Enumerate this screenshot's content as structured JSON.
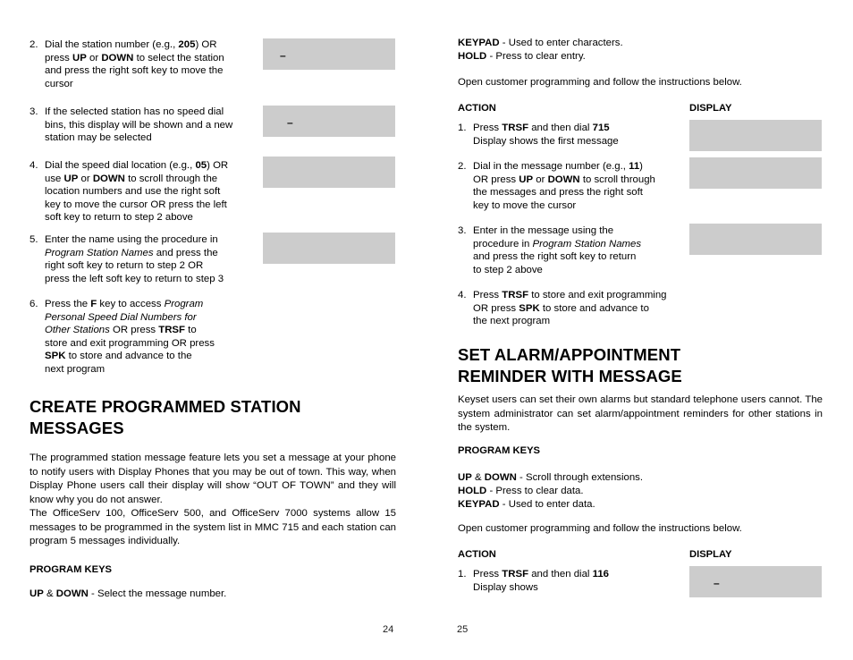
{
  "document": {
    "page_numbers": {
      "left": "24",
      "right": "25"
    },
    "display_box_marker": "–"
  },
  "left_column": {
    "steps": [
      {
        "num": "2.",
        "lines": [
          [
            {
              "t": "Dial the station number (e.g., ",
              "s": "n"
            },
            {
              "t": "205",
              "s": "b"
            },
            {
              "t": ") OR",
              "s": "n"
            }
          ],
          [
            {
              "t": "press ",
              "s": "n"
            },
            {
              "t": "UP",
              "s": "b"
            },
            {
              "t": " or ",
              "s": "n"
            },
            {
              "t": "DOWN",
              "s": "b"
            },
            {
              "t": " to select the station",
              "s": "n"
            }
          ],
          [
            {
              "t": "and press the right soft key to move the",
              "s": "n"
            }
          ],
          [
            {
              "t": "cursor",
              "s": "n"
            }
          ]
        ]
      },
      {
        "num": "3.",
        "lines": [
          [
            {
              "t": "If the selected station has no speed dial",
              "s": "n"
            }
          ],
          [
            {
              "t": "bins, this display will be shown and a new",
              "s": "n"
            }
          ],
          [
            {
              "t": "station may be selected",
              "s": "n"
            }
          ]
        ]
      },
      {
        "num": "4.",
        "lines": [
          [
            {
              "t": "Dial the speed dial location (e.g., ",
              "s": "n"
            },
            {
              "t": "05",
              "s": "b"
            },
            {
              "t": ") OR",
              "s": "n"
            }
          ],
          [
            {
              "t": "use ",
              "s": "n"
            },
            {
              "t": "UP",
              "s": "b"
            },
            {
              "t": " or ",
              "s": "n"
            },
            {
              "t": "DOWN",
              "s": "b"
            },
            {
              "t": " to scroll through the",
              "s": "n"
            }
          ],
          [
            {
              "t": "location numbers and use the right soft",
              "s": "n"
            }
          ],
          [
            {
              "t": "key to move the cursor OR press the left",
              "s": "n"
            }
          ],
          [
            {
              "t": "soft key to return to step 2 above",
              "s": "n"
            }
          ]
        ]
      },
      {
        "num": "5.",
        "lines": [
          [
            {
              "t": "Enter the name using the procedure in",
              "s": "n"
            }
          ],
          [
            {
              "t": "Program Station Names",
              "s": "i"
            },
            {
              "t": " and press the",
              "s": "n"
            }
          ],
          [
            {
              "t": "right soft key to return to step 2 OR",
              "s": "n"
            }
          ],
          [
            {
              "t": "press the left soft key to return to step 3",
              "s": "n"
            }
          ]
        ]
      },
      {
        "num": "6.",
        "lines": [
          [
            {
              "t": "Press the ",
              "s": "n"
            },
            {
              "t": "F",
              "s": "b"
            },
            {
              "t": " key to access ",
              "s": "n"
            },
            {
              "t": "Program",
              "s": "i"
            }
          ],
          [
            {
              "t": "Personal Speed Dial Numbers for",
              "s": "i"
            }
          ],
          [
            {
              "t": "Other Stations",
              "s": "i"
            },
            {
              "t": " OR press ",
              "s": "n"
            },
            {
              "t": "TRSF",
              "s": "b"
            },
            {
              "t": " to",
              "s": "n"
            }
          ],
          [
            {
              "t": "store and exit programming OR press",
              "s": "n"
            }
          ],
          [
            {
              "t": "SPK",
              "s": "b"
            },
            {
              "t": " to store and advance to the",
              "s": "n"
            }
          ],
          [
            {
              "t": "next program",
              "s": "n"
            }
          ]
        ]
      }
    ],
    "display_boxes": [
      {
        "marker": "–"
      },
      {
        "marker": "–"
      },
      {
        "marker": ""
      },
      {
        "marker": ""
      }
    ],
    "heading": {
      "line1": "CREATE PROGRAMMED STATION",
      "line2": "MESSAGES"
    },
    "paragraph_1": "The programmed station message feature lets you set a message at your phone to notify users with Display Phones that you may be out of town. This way, when Display Phone users call their display will show “OUT OF TOWN” and they will know why you do not answer.",
    "paragraph_2": "The OfficeServ 100, OfficeServ 500, and OfficeServ 7000 systems allow 15 messages to be programmed in the system list in MMC 715 and each station can program 5 messages individually.",
    "program_keys_heading": "PROGRAM KEYS",
    "program_keys": [
      [
        {
          "t": "UP",
          "s": "b"
        },
        {
          "t": " & ",
          "s": "n"
        },
        {
          "t": "DOWN",
          "s": "b"
        },
        {
          "t": " - Select the message number.",
          "s": "n"
        }
      ]
    ]
  },
  "right_column": {
    "key_defs_top": [
      [
        {
          "t": "KEYPAD",
          "s": "b"
        },
        {
          "t": " - Used to enter characters.",
          "s": "n"
        }
      ],
      [
        {
          "t": "HOLD",
          "s": "b"
        },
        {
          "t": " - Press to clear entry.",
          "s": "n"
        }
      ]
    ],
    "open_programming_1": "Open customer programming and follow the instructions below.",
    "table_head_1": {
      "action": "ACTION",
      "display": "DISPLAY"
    },
    "steps_1": [
      {
        "num": "1.",
        "lines": [
          [
            {
              "t": "Press ",
              "s": "n"
            },
            {
              "t": "TRSF",
              "s": "b"
            },
            {
              "t": " and then dial ",
              "s": "n"
            },
            {
              "t": "715",
              "s": "b"
            }
          ],
          [
            {
              "t": "Display shows the first message",
              "s": "n"
            }
          ]
        ]
      },
      {
        "num": "2.",
        "lines": [
          [
            {
              "t": "Dial in the message number (e.g., ",
              "s": "n"
            },
            {
              "t": "11",
              "s": "b"
            },
            {
              "t": ")",
              "s": "n"
            }
          ],
          [
            {
              "t": "OR press ",
              "s": "n"
            },
            {
              "t": "UP",
              "s": "b"
            },
            {
              "t": " or ",
              "s": "n"
            },
            {
              "t": "DOWN",
              "s": "b"
            },
            {
              "t": " to scroll through",
              "s": "n"
            }
          ],
          [
            {
              "t": "the messages and press the right soft",
              "s": "n"
            }
          ],
          [
            {
              "t": "key to move the cursor",
              "s": "n"
            }
          ]
        ]
      },
      {
        "num": "3.",
        "lines": [
          [
            {
              "t": "Enter in the message using the",
              "s": "n"
            }
          ],
          [
            {
              "t": "procedure in ",
              "s": "n"
            },
            {
              "t": "Program Station Names",
              "s": "i"
            }
          ],
          [
            {
              "t": "and press the right soft key to return",
              "s": "n"
            }
          ],
          [
            {
              "t": "to step 2 above",
              "s": "n"
            }
          ]
        ]
      },
      {
        "num": "4.",
        "lines": [
          [
            {
              "t": "Press ",
              "s": "n"
            },
            {
              "t": "TRSF",
              "s": "b"
            },
            {
              "t": " to store and exit programming",
              "s": "n"
            }
          ],
          [
            {
              "t": "OR press ",
              "s": "n"
            },
            {
              "t": "SPK",
              "s": "b"
            },
            {
              "t": " to store and advance to",
              "s": "n"
            }
          ],
          [
            {
              "t": "the next program",
              "s": "n"
            }
          ]
        ]
      }
    ],
    "display_boxes_1": [
      {
        "marker": ""
      },
      {
        "marker": ""
      },
      {
        "marker": ""
      }
    ],
    "heading": {
      "line1": "SET ALARM/APPOINTMENT",
      "line2": "REMINDER WITH MESSAGE"
    },
    "paragraph": "Keyset users can set their own alarms but standard telephone users cannot. The system administrator can set alarm/appointment reminders for other stations in the system.",
    "program_keys_heading": "PROGRAM KEYS",
    "program_keys": [
      [
        {
          "t": "UP",
          "s": "b"
        },
        {
          "t": " & ",
          "s": "n"
        },
        {
          "t": "DOWN",
          "s": "b"
        },
        {
          "t": " - Scroll through extensions.",
          "s": "n"
        }
      ],
      [
        {
          "t": "HOLD",
          "s": "b"
        },
        {
          "t": " - Press to clear data.",
          "s": "n"
        }
      ],
      [
        {
          "t": "KEYPAD",
          "s": "b"
        },
        {
          "t": " - Used to enter data.",
          "s": "n"
        }
      ]
    ],
    "open_programming_2": "Open customer programming and follow the instructions below.",
    "table_head_2": {
      "action": "ACTION",
      "display": "DISPLAY"
    },
    "steps_2": [
      {
        "num": "1.",
        "lines": [
          [
            {
              "t": "Press ",
              "s": "n"
            },
            {
              "t": "TRSF",
              "s": "b"
            },
            {
              "t": " and then dial ",
              "s": "n"
            },
            {
              "t": "116",
              "s": "b"
            }
          ],
          [
            {
              "t": "Display shows",
              "s": "n"
            }
          ]
        ]
      }
    ],
    "display_boxes_2": [
      {
        "marker": "–"
      }
    ]
  }
}
